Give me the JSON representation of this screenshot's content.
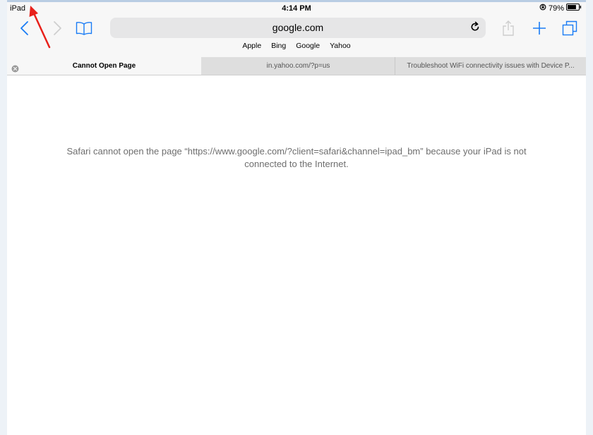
{
  "status_bar": {
    "carrier": "iPad",
    "time": "4:14 PM",
    "battery": "79%",
    "battery_level": 0.79,
    "lock_icon": "rotation-lock-icon"
  },
  "toolbar": {
    "back_icon": "chevron-left-icon",
    "forward_icon": "chevron-right-icon",
    "bookmarks_icon": "book-icon",
    "address": "google.com",
    "reload_icon": "reload-icon",
    "share_icon": "share-icon",
    "new_tab_icon": "plus-icon",
    "tabs_icon": "tabs-icon",
    "accent_color": "#1a7cf5"
  },
  "favorites": [
    "Apple",
    "Bing",
    "Google",
    "Yahoo"
  ],
  "tabs": [
    {
      "label": "Cannot Open Page",
      "active": true
    },
    {
      "label": "in.yahoo.com/?p=us",
      "active": false
    },
    {
      "label": "Troubleshoot WiFi connectivity issues with Device P...",
      "active": false
    }
  ],
  "content": {
    "message": "Safari cannot open the page “https://www.google.com/?client=safari&channel=ipad_bm” because your iPad is not connected to the Internet."
  },
  "annotation": {
    "color": "#e8201a"
  }
}
